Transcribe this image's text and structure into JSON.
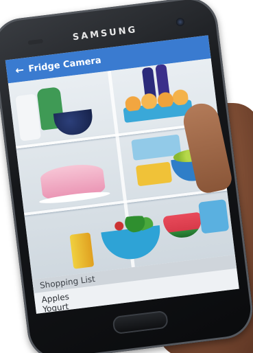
{
  "device": {
    "brand": "SAMSUNG"
  },
  "app_bar": {
    "back_icon": "arrow-left-icon",
    "title": "Fridge Camera"
  },
  "shopping_list": {
    "title": "Shopping List",
    "items": [
      "Apples",
      "Yogurt"
    ]
  },
  "colors": {
    "app_bar": "#3a7bd0",
    "phone_body": "#15171a"
  }
}
